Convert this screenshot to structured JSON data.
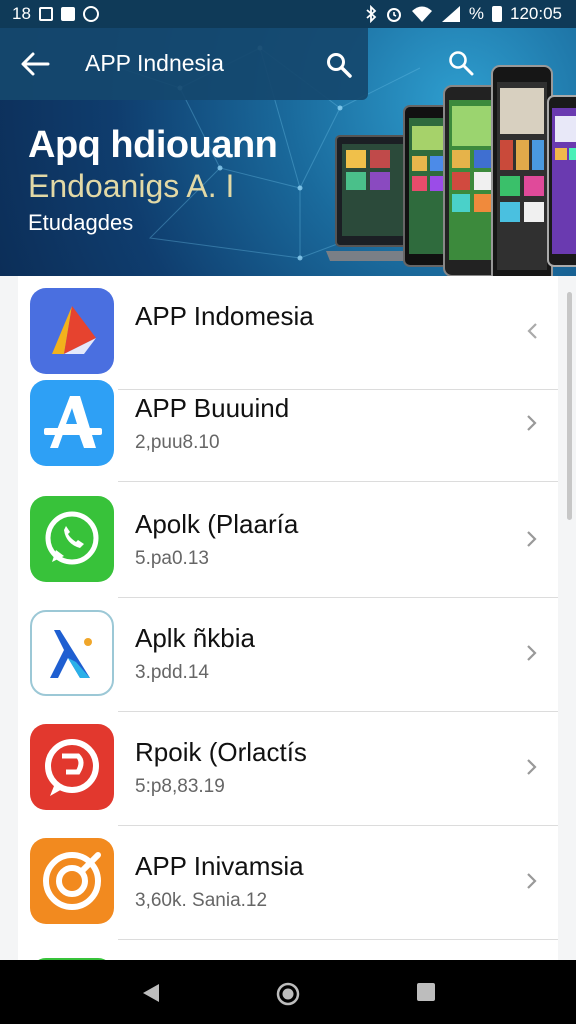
{
  "status_bar": {
    "left_number": "18",
    "time": "120:05",
    "battery_text": "%"
  },
  "toolbar": {
    "title": "APP Indnesia"
  },
  "hero": {
    "headline": "Apq hdiouann",
    "subline": "Endoanigs A.   I",
    "tagline": "Etudagdes"
  },
  "apps": [
    {
      "name": "APP Indomesia",
      "sub": "",
      "icon": "app-store-triangle-icon",
      "color": "#4a6fe0"
    },
    {
      "name": "APP Buuuind",
      "sub": "2,puu8.10",
      "icon": "app-store-a-icon",
      "color": "#2ea0f5"
    },
    {
      "name": "Apolk (Plaaría",
      "sub": "5.pa0.13",
      "icon": "whatsapp-icon",
      "color": "#38c23a"
    },
    {
      "name": "Aplk ñkbia",
      "sub": "3.pdd.14",
      "icon": "lambda-icon",
      "color": "#ffffff"
    },
    {
      "name": "Rpoik (Orlactís",
      "sub": "5:p8,83.19",
      "icon": "chat-bubble-icon",
      "color": "#e2382e"
    },
    {
      "name": "APP Inivamsia",
      "sub": "3,60k. Sania.12",
      "icon": "target-icon",
      "color": "#f28a1f"
    }
  ],
  "nav": {
    "back": "back-triangle-icon",
    "home": "home-circle-icon",
    "recents": "recents-square-icon"
  }
}
